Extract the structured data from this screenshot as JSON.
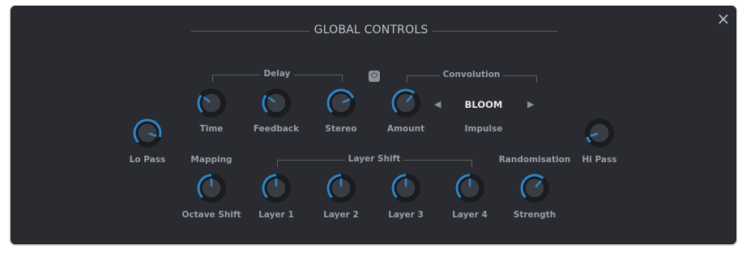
{
  "close_icon": "×",
  "title": "GLOBAL CONTROLS",
  "power_icon": "⏻",
  "groups": {
    "delay": "Delay",
    "convolution": "Convolution",
    "layer_shift": "Layer Shift"
  },
  "convolution": {
    "impulse_value": "BLOOM",
    "prev_icon": "◀",
    "next_icon": "▶"
  },
  "labels": {
    "lo_pass": "Lo Pass",
    "time": "Time",
    "feedback": "Feedback",
    "stereo": "Stereo",
    "amount": "Amount",
    "impulse": "Impulse",
    "hi_pass": "Hi Pass",
    "mapping": "Mapping",
    "randomisation": "Randomisation",
    "octave_shift": "Octave Shift",
    "layer1": "Layer 1",
    "layer2": "Layer 2",
    "layer3": "Layer 3",
    "layer4": "Layer 4",
    "strength": "Strength"
  },
  "knobs": {
    "lo_pass": 0.9,
    "time": 0.3,
    "feedback": 0.3,
    "stereo": 0.75,
    "amount": 0.65,
    "hi_pass": 0.1,
    "octave_shift": 0.5,
    "layer1": 0.5,
    "layer2": 0.5,
    "layer3": 0.5,
    "layer4": 0.5,
    "strength": 0.65
  },
  "colors": {
    "panel": "#2a2b31",
    "accent": "#2f86c9",
    "text": "#9a9da6"
  }
}
